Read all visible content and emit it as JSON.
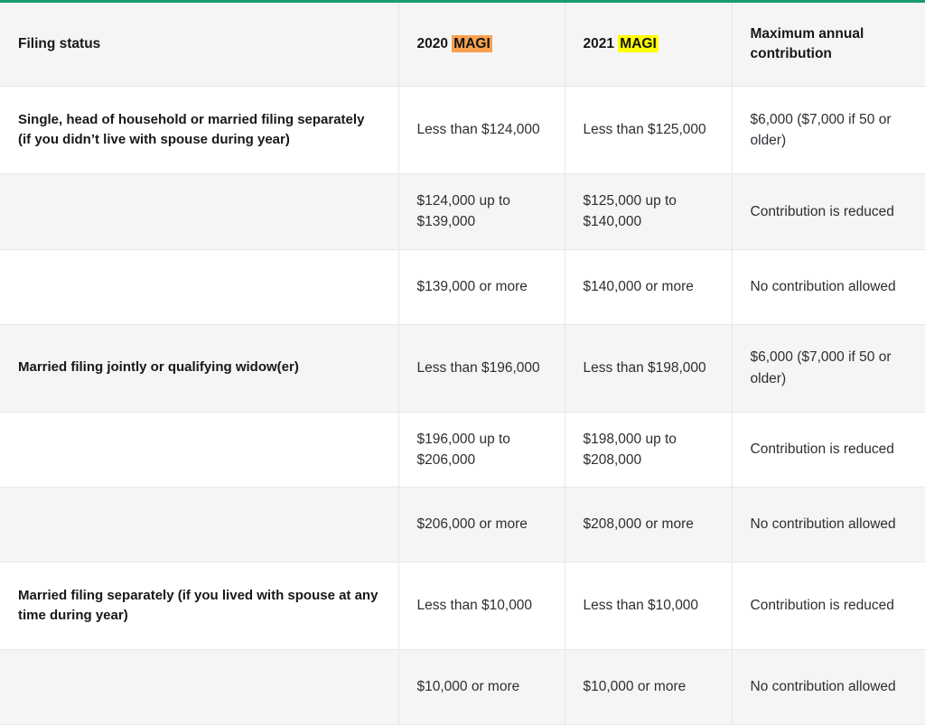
{
  "table": {
    "accent_color": "#189e6e",
    "header_bg": "#f5f5f5",
    "stripe_bg": "#f5f5f5",
    "highlight_orange": "#f9a14f",
    "highlight_yellow": "#ffff00",
    "columns": [
      {
        "key": "filing_status",
        "label": "Filing status"
      },
      {
        "key": "magi_2020",
        "label_prefix": "2020 ",
        "label_highlight": "MAGI",
        "highlight_color": "#f9a14f"
      },
      {
        "key": "magi_2021",
        "label_prefix": "2021 ",
        "label_highlight": "MAGI",
        "highlight_color": "#ffff00"
      },
      {
        "key": "max_contribution",
        "label": "Maximum annual contribution"
      }
    ],
    "rows": [
      {
        "filing_status": "Single, head of household or married filing separately (if you didn’t live with spouse during year)",
        "magi_2020": "Less than $124,000",
        "magi_2021": "Less than $125,000",
        "max_contribution": "$6,000 ($7,000 if 50 or older)",
        "shade": "white"
      },
      {
        "filing_status": "",
        "magi_2020": "$124,000 up to $139,000",
        "magi_2021": "$125,000 up to $140,000",
        "max_contribution": "Contribution is reduced",
        "shade": "grey"
      },
      {
        "filing_status": "",
        "magi_2020": "$139,000 or more",
        "magi_2021": "$140,000 or more",
        "max_contribution": "No contribution allowed",
        "shade": "white"
      },
      {
        "filing_status": "Married filing jointly or qualifying widow(er)",
        "magi_2020": "Less than $196,000",
        "magi_2021": "Less than $198,000",
        "max_contribution": "$6,000 ($7,000 if 50 or older)",
        "shade": "grey"
      },
      {
        "filing_status": "",
        "magi_2020": "$196,000 up to $206,000",
        "magi_2021": "$198,000 up to $208,000",
        "max_contribution": "Contribution is reduced",
        "shade": "white"
      },
      {
        "filing_status": "",
        "magi_2020": "$206,000 or more",
        "magi_2021": "$208,000 or more",
        "max_contribution": "No contribution allowed",
        "shade": "grey"
      },
      {
        "filing_status": "Married filing separately (if you lived with spouse at any time during year)",
        "magi_2020": "Less than $10,000",
        "magi_2021": "Less than $10,000",
        "max_contribution": "Contribution is reduced",
        "shade": "white"
      },
      {
        "filing_status": "",
        "magi_2020": "$10,000 or more",
        "magi_2021": "$10,000 or more",
        "max_contribution": "No contribution allowed",
        "shade": "grey"
      }
    ]
  }
}
